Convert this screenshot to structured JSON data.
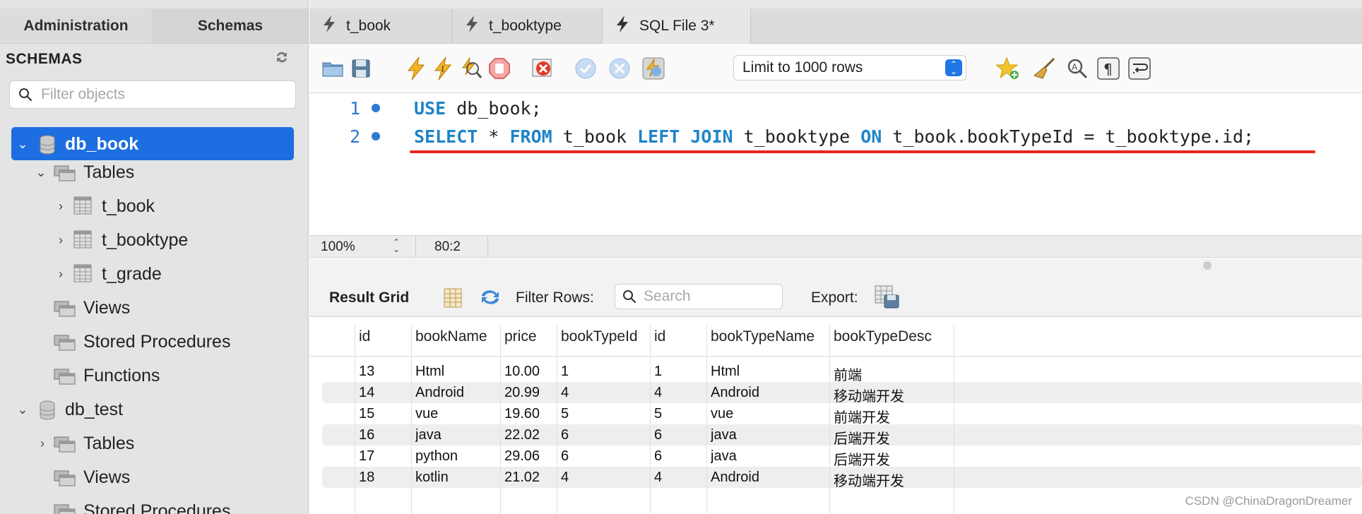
{
  "sidebar": {
    "tabs": [
      "Administration",
      "Schemas"
    ],
    "header": "SCHEMAS",
    "filter_placeholder": "Filter objects",
    "tree": [
      {
        "label": "db_book"
      },
      {
        "label": "Tables"
      },
      {
        "label": "t_book"
      },
      {
        "label": "t_booktype"
      },
      {
        "label": "t_grade"
      },
      {
        "label": "Views"
      },
      {
        "label": "Stored Procedures"
      },
      {
        "label": "Functions"
      },
      {
        "label": "db_test"
      },
      {
        "label": "Tables"
      },
      {
        "label": "Views"
      },
      {
        "label": "Stored Procedures"
      }
    ]
  },
  "editor_tabs": [
    {
      "label": "t_book"
    },
    {
      "label": "t_booktype"
    },
    {
      "label": "SQL File 3*"
    }
  ],
  "toolbar": {
    "limit_label": "Limit to 1000 rows"
  },
  "editor": {
    "lines": [
      {
        "num": "1"
      },
      {
        "num": "2"
      }
    ],
    "line1": {
      "kw1": "USE",
      "rest": " db_book;"
    },
    "line2": {
      "t1": "SELECT",
      "t2": " * ",
      "t3": "FROM",
      "t4": " t_book ",
      "t5": "LEFT JOIN",
      "t6": " t_booktype ",
      "t7": "ON",
      "t8": " t_book.bookTypeId = t_booktype.id;"
    }
  },
  "status": {
    "zoom": "100%",
    "cursor": "80:2"
  },
  "result": {
    "title": "Result Grid",
    "filter_label": "Filter Rows:",
    "search_placeholder": "Search",
    "export_label": "Export:",
    "columns": [
      "id",
      "bookName",
      "price",
      "bookTypeId",
      "id",
      "bookTypeName",
      "bookTypeDesc"
    ],
    "rows": [
      [
        "13",
        "Html",
        "10.00",
        "1",
        "1",
        "Html",
        "前端"
      ],
      [
        "14",
        "Android",
        "20.99",
        "4",
        "4",
        "Android",
        "移动端开发"
      ],
      [
        "15",
        "vue",
        "19.60",
        "5",
        "5",
        "vue",
        "前端开发"
      ],
      [
        "16",
        "java",
        "22.02",
        "6",
        "6",
        "java",
        "后端开发"
      ],
      [
        "17",
        "python",
        "29.06",
        "6",
        "6",
        "java",
        "后端开发"
      ],
      [
        "18",
        "kotlin",
        "21.02",
        "4",
        "4",
        "Android",
        "移动端开发"
      ]
    ]
  },
  "watermark": "CSDN @ChinaDragonDreamer",
  "colors": {
    "keyword": "#1f84c7",
    "selection": "#1d6ee0",
    "underline": "#e8251d",
    "line_number": "#2c7bd3"
  }
}
